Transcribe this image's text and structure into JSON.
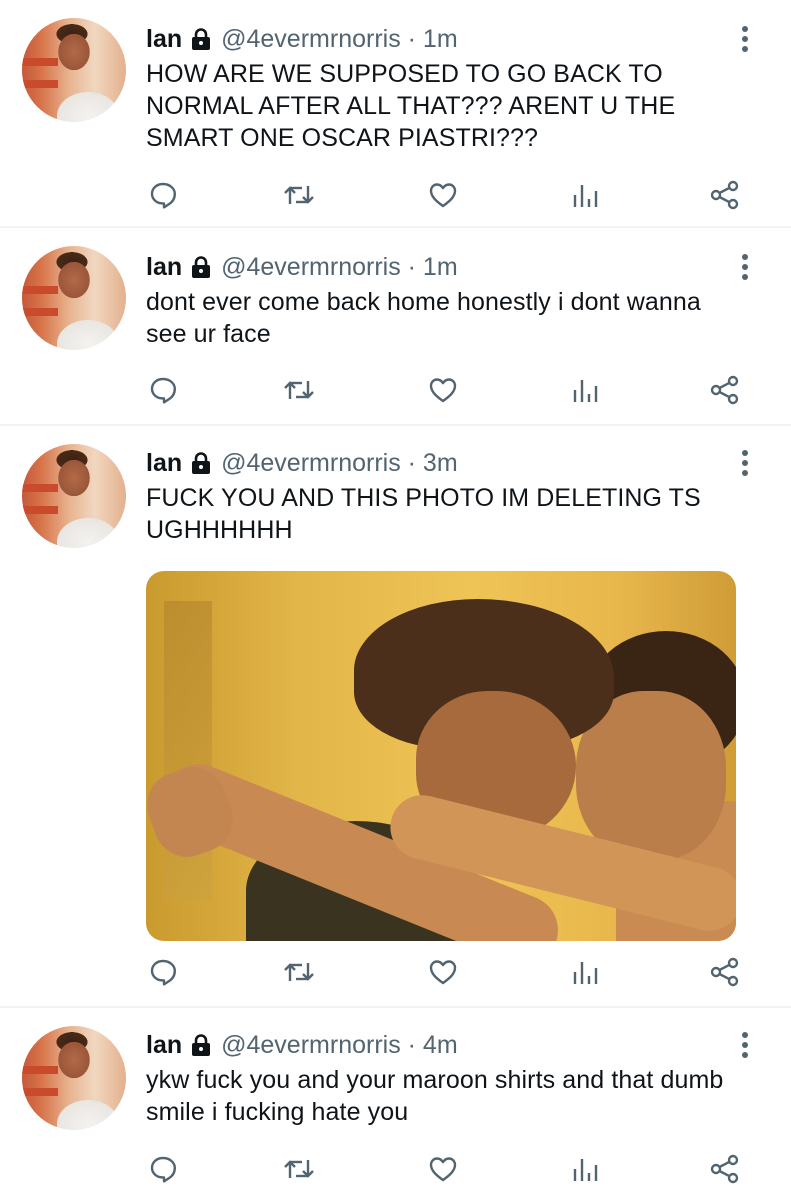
{
  "colors": {
    "text_primary": "#0f1419",
    "text_secondary": "#536471",
    "divider": "#eff3f4"
  },
  "icons": {
    "reply": "reply-icon",
    "retweet": "retweet-icon",
    "like": "heart-icon",
    "views": "analytics-icon",
    "share": "share-icon",
    "lock": "lock-icon",
    "more": "more-vertical-icon"
  },
  "tweets": [
    {
      "name": "lan",
      "handle_time": "@4evermrnorris · 1m",
      "text": "HOW ARE WE SUPPOSED TO GO BACK TO NORMAL AFTER ALL THAT??? ARENT U THE SMART ONE OSCAR PIASTRI???"
    },
    {
      "name": "lan",
      "handle_time": "@4evermrnorris · 1m",
      "text": "dont ever come back home honestly i dont wanna see ur face"
    },
    {
      "name": "lan",
      "handle_time": "@4evermrnorris · 3m",
      "text": "FUCK YOU AND THIS PHOTO IM DELETING TS UGHHHHHH",
      "has_photo": true
    },
    {
      "name": "lan",
      "handle_time": "@4evermrnorris · 4m",
      "text": "ykw fuck you and your maroon shirts and that dumb smile i fucking hate you"
    }
  ]
}
